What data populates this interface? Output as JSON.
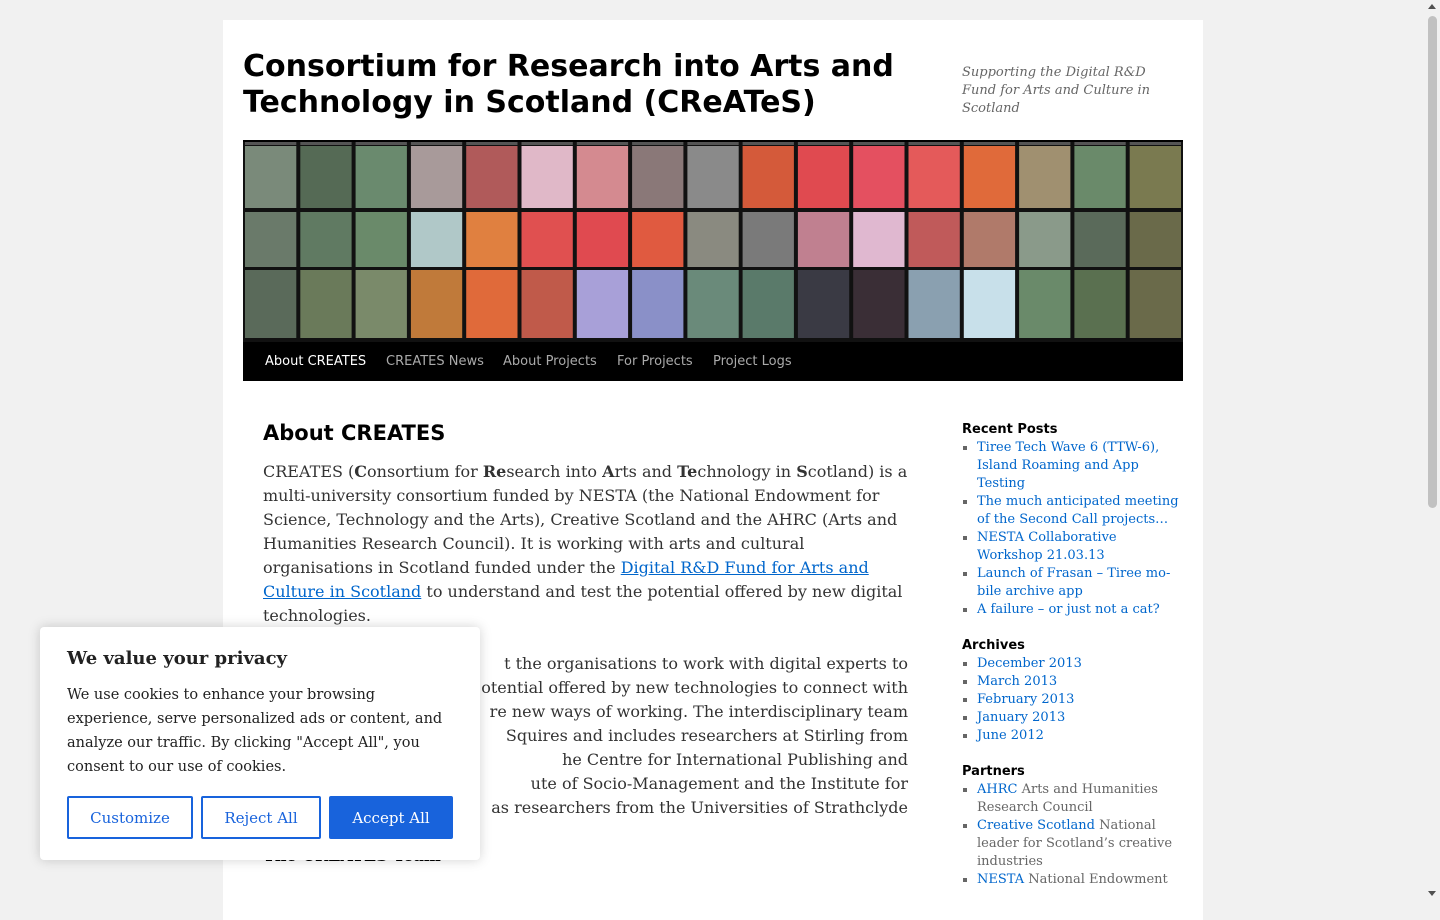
{
  "site": {
    "title": "Consortium for Research into Arts and Technology in Scotland (CReATeS)",
    "description": "Supporting the Digital R&D Fund for Arts and Culture in Scotland"
  },
  "nav": {
    "items": [
      {
        "label": "About CREATES",
        "current": true
      },
      {
        "label": "CREATES News"
      },
      {
        "label": "About Projects"
      },
      {
        "label": "For Projects"
      },
      {
        "label": "Project Logs"
      }
    ]
  },
  "content": {
    "heading": "About CREATES",
    "p1": {
      "lead": "CREATES (",
      "c": "C",
      "onsortium": "onsortium for  ",
      "re": "Re",
      "search": "search into ",
      "a": "A",
      "rts": "rts and ",
      "te": "Te",
      "chnology": "chnology in ",
      "s": "S",
      "rest": "cotland) is a multi-university consortium funded by NESTA (the National Endowment for Science, Technology and the Arts), Creative Scotland and the AHRC (Arts and Humanities Research Council).  It is working with arts and cultural organisations in Scotland funded under the ",
      "link": "Digital R&D Fund for Arts and Culture in Scotland",
      "tail": " to understand and test the potential offered by new digital technologies."
    },
    "p2": "… the organisations to work with digital experts to … potential offered by new technologies to connect with … re new ways of working. The interdisciplinary team … Squires and includes researchers at Stirling from … the Centre for International Publishing and … ute of Socio-Management and the Institute for … as researchers from the Universities of Strathclyde",
    "p2_lines": [
      "t the organisations to work with digital experts to",
      "otential offered by new technologies to connect with",
      "re new ways of working. The interdisciplinary team",
      "Squires and includes researchers at Stirling from",
      "he Centre for International Publishing and",
      "ute of Socio-Management and the Institute for",
      "as researchers from the Universities of Strathclyde"
    ],
    "team_heading": "The CREATES Team"
  },
  "sidebar": {
    "recent_title": "Recent Posts",
    "recent": [
      "Tiree Tech Wave 6 (TTW-6), Island Roaming and App Testing",
      "The much anticipated meet­ing of the Second Call projects…",
      "NESTA Collaborative Workshop 21.03.13",
      "Launch of Frasan – Tiree mo­bile archive app",
      "A failure – or just not a cat?"
    ],
    "archives_title": "Archives",
    "archives": [
      "December 2013",
      "March 2013",
      "February 2013",
      "January 2013",
      "June 2012"
    ],
    "partners_title": "Partners",
    "partners": [
      {
        "link": "AHRC",
        "desc": " Arts and Humanities Research Council"
      },
      {
        "link": "Creative Scotland",
        "desc": " National leader for Scotland’s creative industries"
      },
      {
        "link": "NESTA",
        "desc": " National Endowment"
      }
    ]
  },
  "cookie": {
    "title": "We value your privacy",
    "text": "We use cookies to enhance your browsing experience, serve personalized ads or content, and analyze our traffic. By clicking \"Accept All\", you consent to our use of cookies.",
    "customize": "Customize",
    "reject": "Reject All",
    "accept": "Accept All"
  },
  "colors": {
    "link": "#0066cc",
    "cookie_accent": "#1863dc",
    "nav_bg": "#000000"
  }
}
